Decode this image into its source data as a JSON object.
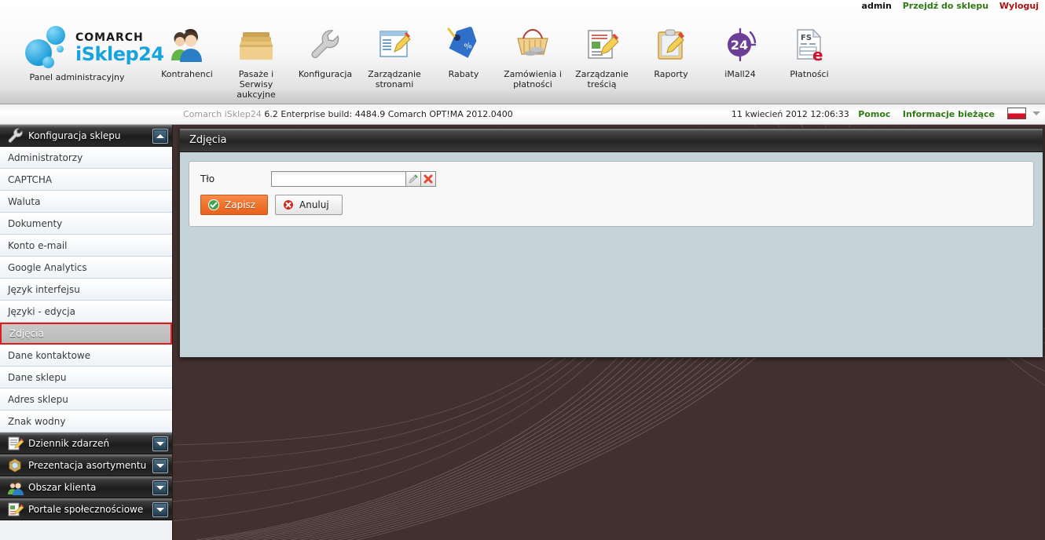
{
  "account_bar": {
    "user": "admin",
    "go_to_shop": "Przejdź do sklepu",
    "logout": "Wyloguj"
  },
  "toolbar": {
    "brand": {
      "line1": "COMARCH",
      "line2": "iSklep24",
      "label": "Panel administracyjny"
    },
    "items": [
      {
        "label": "Kontrahenci",
        "icon": "users-icon"
      },
      {
        "label": "Pasaże i Serwisy aukcyjne",
        "icon": "folders-icon"
      },
      {
        "label": "Konfiguracja",
        "icon": "wrench-icon"
      },
      {
        "label": "Zarządzanie stronami",
        "icon": "page-edit-icon"
      },
      {
        "label": "Rabaty",
        "icon": "price-tag-percent-icon"
      },
      {
        "label": "Zamówienia i płatności",
        "icon": "basket-coins-icon"
      },
      {
        "label": "Zarządzanie treścią",
        "icon": "document-edit-icon"
      },
      {
        "label": "Raporty",
        "icon": "clipboard-pencil-icon"
      },
      {
        "label": "iMall24",
        "icon": "imall24-badge-icon",
        "badge": "24"
      },
      {
        "label": "Płatności",
        "icon": "invoice-fs-icon",
        "doc_code": "FS",
        "doc_mark": "e"
      }
    ]
  },
  "info_strip": {
    "product": "Comarch iSklep24",
    "version": "6.2 Enterprise build: 4484.9  Comarch OPT!MA 2012.0400",
    "datetime": "11 kwiecień 2012 12:06:33",
    "help": "Pomoc",
    "news": "Informacje bieżące",
    "language_flag": "poland-flag-icon"
  },
  "sidebar": {
    "group_title": "Konfiguracja sklepu",
    "group_icon": "wrench-icon",
    "items": [
      {
        "label": "Administratorzy",
        "selected": false
      },
      {
        "label": "CAPTCHA",
        "selected": false
      },
      {
        "label": "Waluta",
        "selected": false
      },
      {
        "label": "Dokumenty",
        "selected": false
      },
      {
        "label": "Konto e-mail",
        "selected": false
      },
      {
        "label": "Google Analytics",
        "selected": false
      },
      {
        "label": "Język interfejsu",
        "selected": false
      },
      {
        "label": "Języki - edycja",
        "selected": false
      },
      {
        "label": "Zdjęcia",
        "selected": true
      },
      {
        "label": "Dane kontaktowe",
        "selected": false
      },
      {
        "label": "Dane sklepu",
        "selected": false
      },
      {
        "label": "Adres sklepu",
        "selected": false
      },
      {
        "label": "Znak wodny",
        "selected": false
      }
    ],
    "collapsed_groups": [
      {
        "label": "Dziennik zdarzeń",
        "icon": "notepad-pencil-icon"
      },
      {
        "label": "Prezentacja asortymentu",
        "icon": "box-search-icon"
      },
      {
        "label": "Obszar klienta",
        "icon": "users-icon"
      },
      {
        "label": "Portale społecznościowe",
        "icon": "page-pencil-icon"
      }
    ]
  },
  "content": {
    "title": "Zdjęcia",
    "form": {
      "field_label": "Tło",
      "field_value": "",
      "field_placeholder": "",
      "pick_icon": "eyedropper-icon",
      "clear_icon": "delete-x-icon",
      "save_label": "Zapisz",
      "cancel_label": "Anuluj"
    }
  },
  "colors": {
    "page_background": "#42302f",
    "panel_background": "#c6d4da",
    "accent_orange": "#ef7630",
    "link_green": "#2f7a14",
    "link_red": "#b01010",
    "selection_red": "#e01b1b"
  }
}
